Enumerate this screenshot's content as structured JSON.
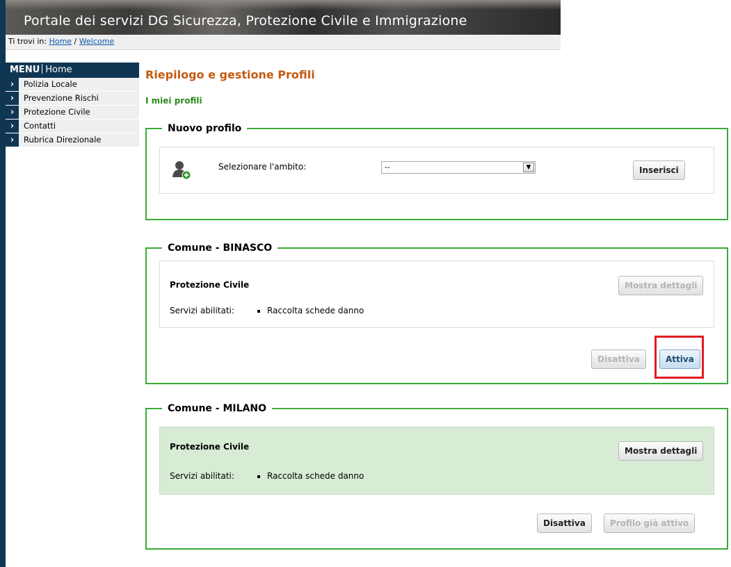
{
  "header": {
    "title": "Portale dei servizi DG Sicurezza, Protezione Civile e Immigrazione"
  },
  "breadcrumb": {
    "prefix": "Ti trovi in:",
    "home": "Home",
    "separator": "/",
    "current": "Welcome"
  },
  "menu": {
    "title": "MENU",
    "home": "Home",
    "items": [
      {
        "label": "Polizia Locale",
        "icon": "chevron-right-icon"
      },
      {
        "label": "Prevenzione Rischi",
        "icon": "chevron-right-icon"
      },
      {
        "label": "Protezione Civile",
        "icon": "chevron-right-icon"
      },
      {
        "label": "Contatti",
        "icon": "chevron-right-icon"
      },
      {
        "label": "Rubrica Direzionale",
        "icon": "chevron-right-icon"
      }
    ]
  },
  "main": {
    "title": "Riepilogo e gestione Profili",
    "subtitle": "I miei profili",
    "new_profile": {
      "legend": "Nuovo profilo",
      "icon": "add-user-icon",
      "select_label": "Selezionare l'ambito:",
      "select_value": "--",
      "insert_button": "Inserisci"
    },
    "profiles": [
      {
        "legend_prefix": "Comune - ",
        "legend_name": "BINASCO",
        "profile_name": "Protezione Civile",
        "details_button": "Mostra dettagli",
        "services_label": "Servizi abilitati:",
        "services": [
          "Raccolta schede danno"
        ],
        "deactivate_button": "Disattiva",
        "activate_button": "Attiva"
      },
      {
        "legend_prefix": "Comune - ",
        "legend_name": "MILANO",
        "profile_name": "Protezione Civile",
        "details_button": "Mostra dettagli",
        "services_label": "Servizi abilitati:",
        "services": [
          "Raccolta schede danno"
        ],
        "deactivate_button": "Disattiva",
        "active_button": "Profilo già attivo"
      }
    ]
  },
  "colors": {
    "menu_bg": "#0f3653",
    "title_orange": "#c45a10",
    "subtitle_green": "#2d8a1e",
    "fieldset_border": "#3aaa35",
    "active_profile_bg": "#d7ebd5",
    "highlight_red": "#e01b22"
  }
}
